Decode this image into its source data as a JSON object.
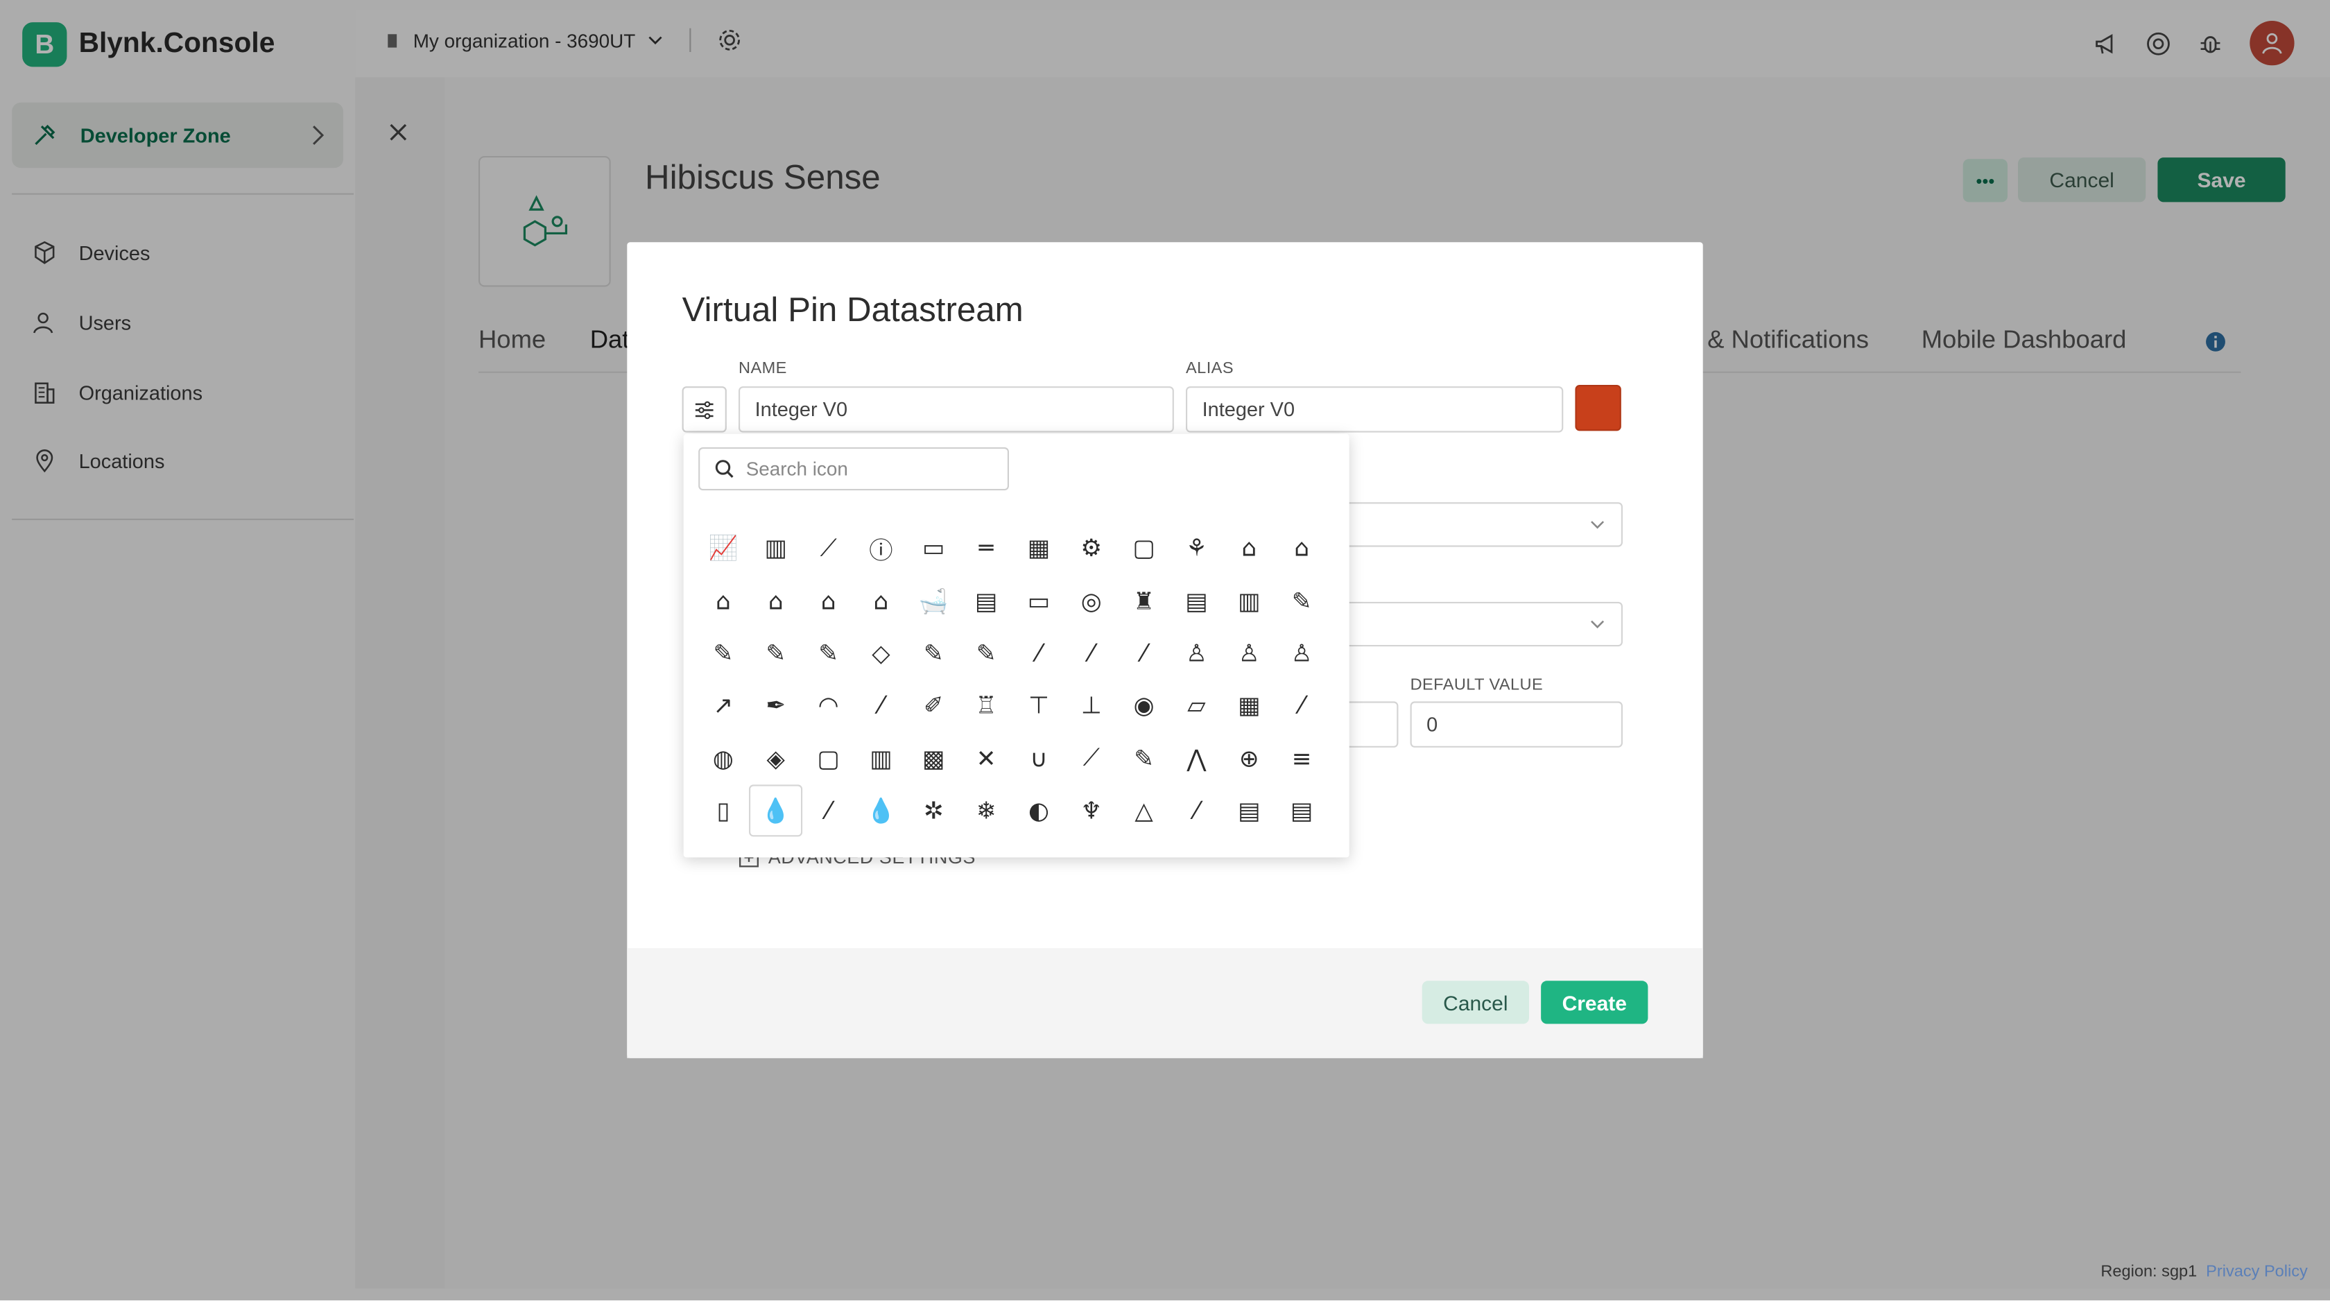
{
  "brand": {
    "name": "Blynk.Console",
    "mark": "B"
  },
  "sidebar": {
    "developer_zone": "Developer Zone",
    "items": [
      {
        "label": "Devices",
        "icon": "cube-icon"
      },
      {
        "label": "Users",
        "icon": "user-icon"
      },
      {
        "label": "Organizations",
        "icon": "building-icon"
      },
      {
        "label": "Locations",
        "icon": "pin-icon"
      }
    ]
  },
  "topbar": {
    "organization": "My organization - 3690UT"
  },
  "template": {
    "title": "Hibiscus Sense",
    "more_label": "•••",
    "cancel_label": "Cancel",
    "save_label": "Save",
    "tabs": [
      "Home",
      "Dat",
      "& Notifications",
      "Mobile Dashboard"
    ]
  },
  "modal": {
    "title": "Virtual Pin Datastream",
    "name_label": "NAME",
    "name_value": "Integer V0",
    "alias_label": "ALIAS",
    "alias_value": "Integer V0",
    "color": "#c8401b",
    "default_value_label": "DEFAULT VALUE",
    "default_value": "0",
    "advanced_label": "ADVANCED SETTINGS",
    "cancel_label": "Cancel",
    "create_label": "Create"
  },
  "icon_picker": {
    "search_placeholder": "Search icon",
    "selected_index": 61,
    "icons": [
      "📈",
      "▥",
      "⟋",
      "ⓘ",
      "▭",
      "═",
      "▦",
      "⚙",
      "▢",
      "⚘",
      "⌂",
      "⌂",
      "⌂",
      "⌂",
      "⌂",
      "⌂",
      "🛁",
      "▤",
      "▭",
      "◎",
      "♜",
      "▤",
      "▥",
      "✎",
      "✎",
      "✎",
      "✎",
      "◇",
      "✎",
      "✎",
      "⁄",
      "⁄",
      "⁄",
      "♙",
      "♙",
      "♙",
      "↗",
      "✒",
      "◠",
      "⁄",
      "✐",
      "♖",
      "⊤",
      "⊥",
      "◉",
      "▱",
      "▦",
      "⁄",
      "◍",
      "◈",
      "▢",
      "▥",
      "▩",
      "✕",
      "∪",
      "⟋",
      "✎",
      "⋀",
      "⊕",
      "≡",
      "▯",
      "💧",
      "⁄",
      "💧",
      "✲",
      "❄",
      "◐",
      "♆",
      "△",
      "⁄",
      "▤",
      "▤"
    ]
  },
  "footer": {
    "region": "Region: sgp1",
    "privacy": "Privacy Policy"
  },
  "colors": {
    "accent": "#1fb583",
    "brand": "#23b37f",
    "dark_green": "#1c8a60"
  }
}
